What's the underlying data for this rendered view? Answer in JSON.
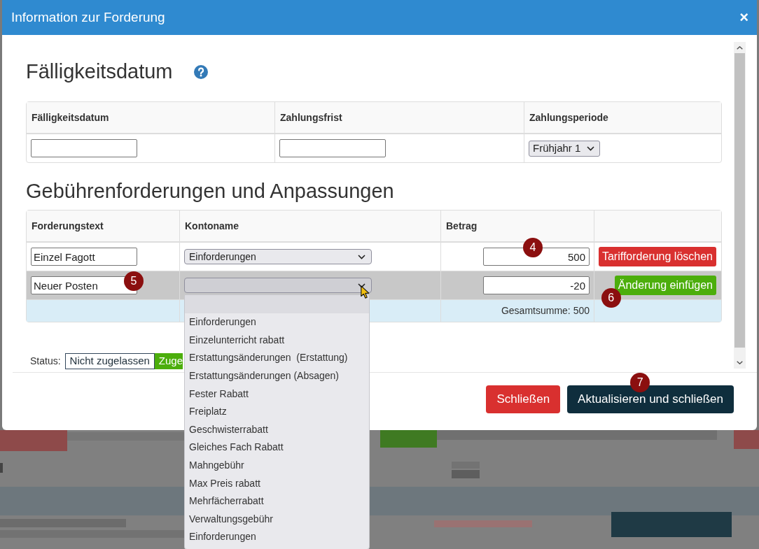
{
  "dialog": {
    "title": "Information zur Forderung",
    "close_label": "×"
  },
  "due_date": {
    "heading": "Fälligkeitsdatum",
    "columns": [
      "Fälligkeitsdatum",
      "Zahlungsfrist",
      "Zahlungsperiode"
    ],
    "fields": [
      {
        "kind": "text"
      },
      {
        "kind": "text"
      },
      {
        "kind": "select",
        "value": "Frühjahr 1"
      }
    ]
  },
  "charges": {
    "heading": "Gebührenforderungen und Anpassungen",
    "columns": [
      "Forderungstext",
      "Kontoname",
      "Betrag"
    ],
    "rows": [
      {
        "highlighted": false,
        "text": "Einzel Fagott",
        "account": {
          "value": "Einforderungen",
          "open": false
        },
        "amount": "500",
        "amount_marker": "4",
        "action": {
          "kind": "delete",
          "label": "Tarifforderung löschen"
        }
      },
      {
        "highlighted": true,
        "text": "Neuer Posten",
        "text_marker": "5",
        "account": {
          "open": true,
          "options": [
            {
              "selected": true
            },
            {
              "label": "Einforderungen",
              "selected": false
            },
            {
              "label": "Einzelunterricht rabatt",
              "selected": false
            },
            {
              "label": "Erstattungsänderungen  (Erstattung)",
              "selected": false
            },
            {
              "label": "Erstattungsänderungen (Absagen)",
              "selected": false
            },
            {
              "label": "Fester Rabatt",
              "selected": false
            },
            {
              "label": "Freiplatz",
              "selected": false
            },
            {
              "label": "Geschwisterrabatt",
              "selected": false
            },
            {
              "label": "Gleiches Fach Rabatt",
              "selected": false
            },
            {
              "label": "Mahngebühr",
              "selected": false
            },
            {
              "label": "Max Preis rabatt",
              "selected": false
            },
            {
              "label": "Mehrfächerrabatt",
              "selected": false
            },
            {
              "label": "Verwaltungsgebühr",
              "selected": false
            },
            {
              "label": "Einforderungen",
              "selected": false
            }
          ]
        },
        "amount": "-20",
        "action": {
          "kind": "add",
          "label": "Änderung einfügen",
          "marker": "6"
        }
      }
    ],
    "total": "Gesamtsumme: 500"
  },
  "status": {
    "label": "Status:",
    "options": [
      {
        "label": "Nicht zugelassen",
        "selected": false
      },
      {
        "label": "Zuge",
        "selected": true
      }
    ]
  },
  "footer_buttons": [
    {
      "kind": "danger",
      "label": "Schließen"
    },
    {
      "kind": "primary",
      "label": "Aktualisieren und schließen",
      "marker": "7"
    }
  ]
}
